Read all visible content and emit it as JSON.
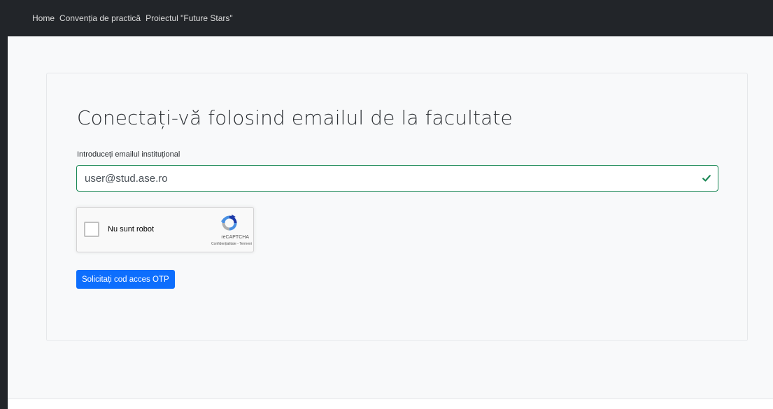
{
  "navbar": {
    "links": [
      {
        "label": "Home"
      },
      {
        "label": "Convenția de practică"
      },
      {
        "label": "Proiectul \"Future Stars\""
      }
    ]
  },
  "form": {
    "heading": "Conectați-vă folosind emailul de la facultate",
    "email_label": "Introduceți emailul instituțional",
    "email_value": "user@stud.ase.ro",
    "email_valid_icon": "check-icon",
    "recaptcha": {
      "checkbox_label": "Nu sunt robot",
      "brand": "reCAPTCHA",
      "privacy_link": "Confidențialitate",
      "separator": " - ",
      "terms_link": "Termeni"
    },
    "submit_label": "Solicitați cod acces OTP"
  },
  "colors": {
    "navbar_bg": "#222529",
    "valid_green": "#198754",
    "primary_button": "#0d6efd",
    "page_bg": "#f8f9fa"
  }
}
